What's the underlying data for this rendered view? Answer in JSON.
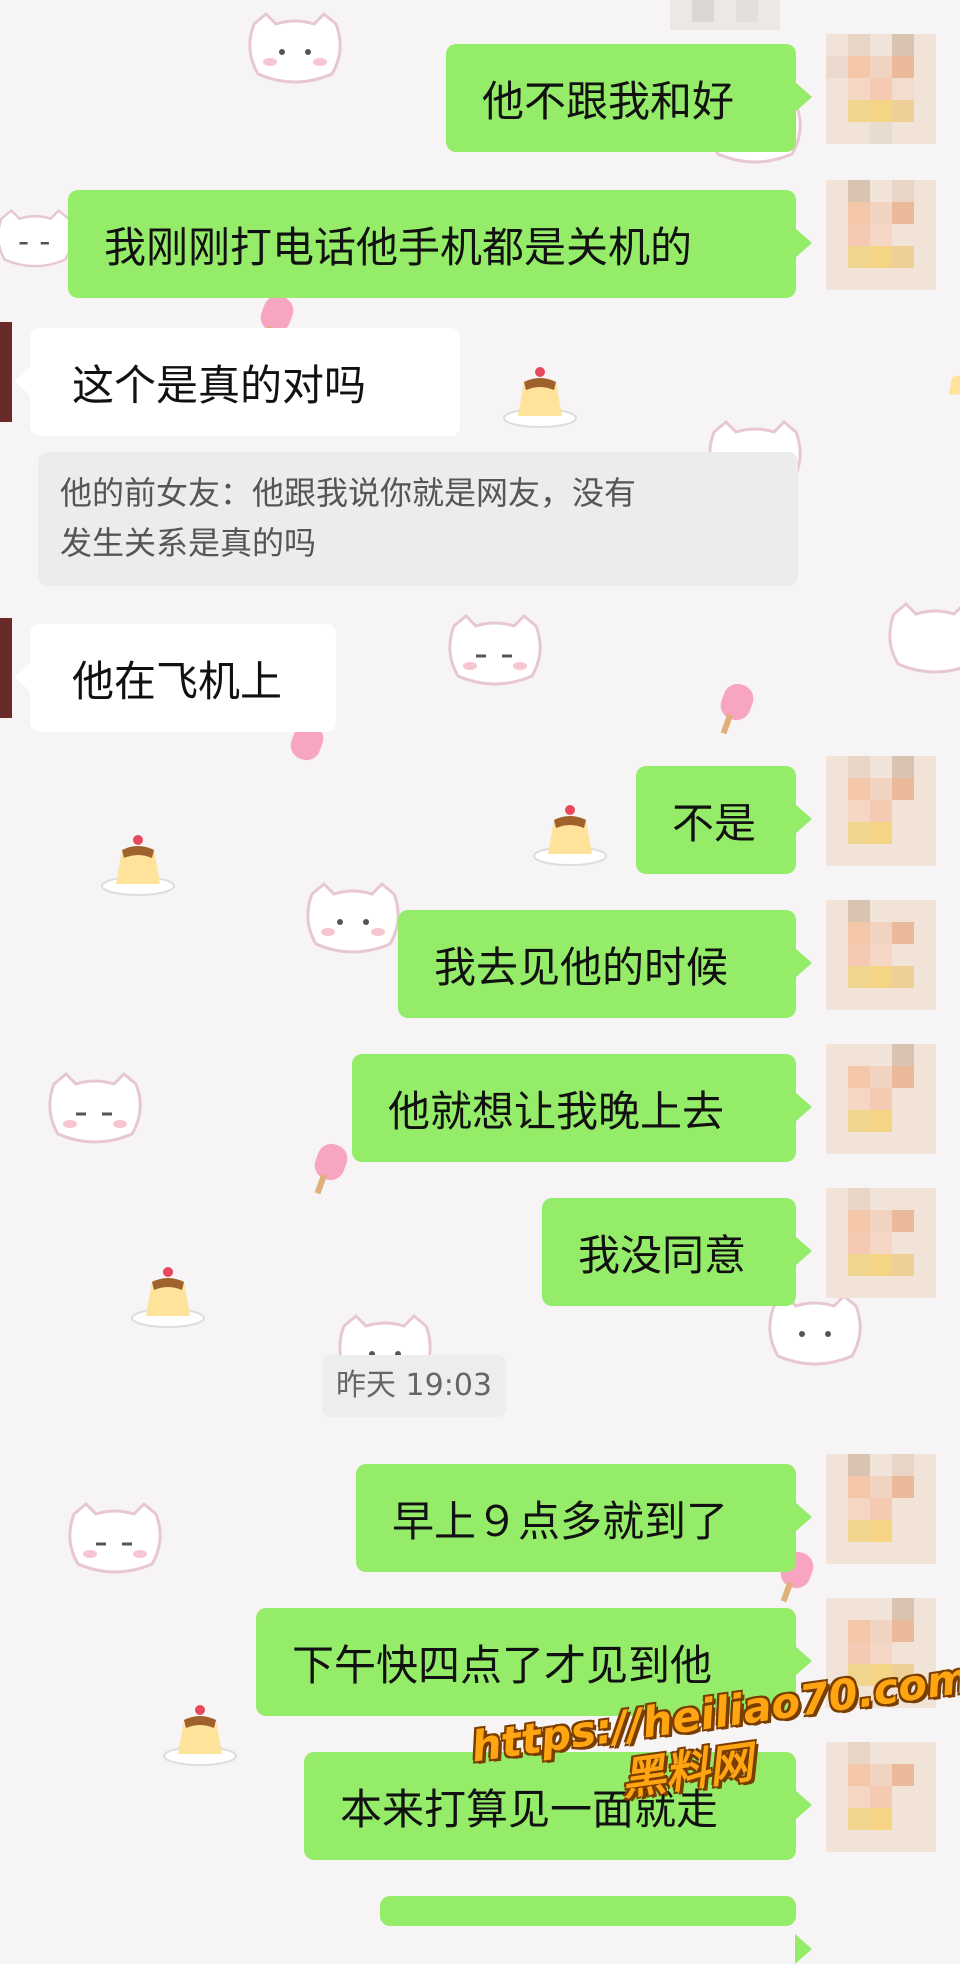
{
  "messages": [
    {
      "text": "他不跟我和好",
      "sender": "me"
    },
    {
      "text": "我刚刚打电话他手机都是关机的",
      "sender": "me"
    },
    {
      "text": "这个是真的对吗",
      "sender": "other"
    },
    {
      "text": "他在飞机上",
      "sender": "other"
    },
    {
      "text": "不是",
      "sender": "me"
    },
    {
      "text": "我去见他的时候",
      "sender": "me"
    },
    {
      "text": "他就想让我晚上去",
      "sender": "me"
    },
    {
      "text": "我没同意",
      "sender": "me"
    },
    {
      "text": "早上９点多就到了",
      "sender": "me"
    },
    {
      "text": "下午快四点了才见到他",
      "sender": "me"
    },
    {
      "text": "本来打算见一面就走",
      "sender": "me"
    }
  ],
  "quote": {
    "line1": "他的前女友：他跟我说你就是网友，没有",
    "line2": "发生关系是真的吗"
  },
  "timestamp": "昨天 19:03",
  "watermark": {
    "url": "https://heiliao70.com",
    "name": "黑料网"
  },
  "colors": {
    "outgoing_bubble": "#95ec69",
    "incoming_bubble": "#ffffff",
    "background": "#f6f4f4",
    "watermark": "#ffa512"
  },
  "icons": {
    "wallpaper": [
      "cat-face-icon",
      "pudding-icon",
      "popsicle-icon"
    ],
    "avatar": "pixelated-avatar"
  }
}
